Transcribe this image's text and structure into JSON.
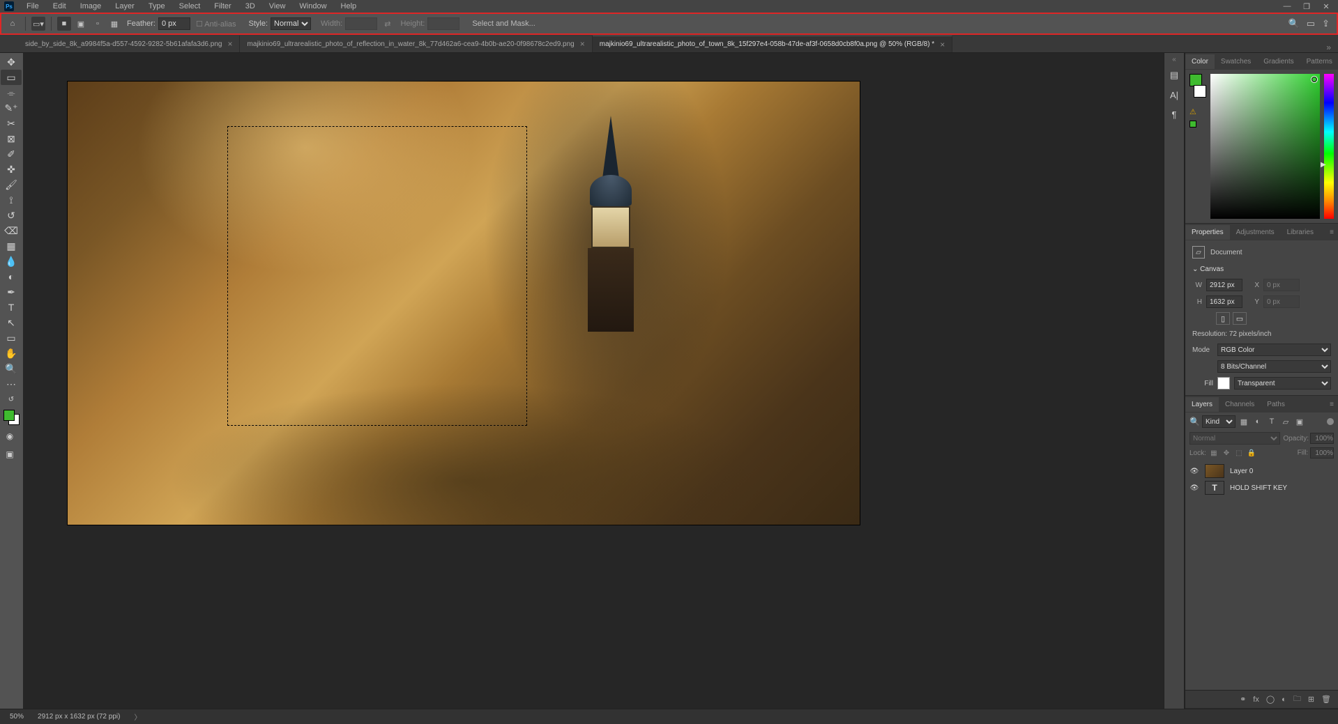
{
  "menu": [
    "File",
    "Edit",
    "Image",
    "Layer",
    "Type",
    "Select",
    "Filter",
    "3D",
    "View",
    "Window",
    "Help"
  ],
  "optionbar": {
    "feather_label": "Feather:",
    "feather_value": "0 px",
    "antialias": "Anti-alias",
    "style_label": "Style:",
    "style_value": "Normal",
    "width_label": "Width:",
    "height_label": "Height:",
    "select_mask": "Select and Mask..."
  },
  "tabs": [
    {
      "label": "side_by_side_8k_a9984f5a-d557-4592-9282-5b61afafa3d6.png",
      "active": false
    },
    {
      "label": "majkinio69_ultrarealistic_photo_of_reflection_in_water_8k_77d462a6-cea9-4b0b-ae20-0f98678c2ed9.png",
      "active": false
    },
    {
      "label": "majkinio69_ultrarealistic_photo_of_town_8k_15f297e4-058b-47de-af3f-0658d0cb8f0a.png @ 50% (RGB/8) *",
      "active": true
    }
  ],
  "color_tabs": [
    "Color",
    "Swatches",
    "Gradients",
    "Patterns"
  ],
  "props_tabs": [
    "Properties",
    "Adjustments",
    "Libraries"
  ],
  "props": {
    "doc_label": "Document",
    "canvas_label": "Canvas",
    "W_label": "W",
    "W": "2912 px",
    "X_label": "X",
    "X": "0 px",
    "H_label": "H",
    "H": "1632 px",
    "Y_label": "Y",
    "Y": "0 px",
    "reso_label": "Resolution:",
    "reso_value": "72 pixels/inch",
    "mode_label": "Mode",
    "mode_value": "RGB Color",
    "bits_value": "8 Bits/Channel",
    "fill_label": "Fill",
    "fill_value": "Transparent"
  },
  "layer_tabs": [
    "Layers",
    "Channels",
    "Paths"
  ],
  "layers": {
    "kind": "Kind",
    "blend": "Normal",
    "opacity_label": "Opacity:",
    "opacity": "100%",
    "lock_label": "Lock:",
    "fill_label": "Fill:",
    "fill": "100%",
    "items": [
      {
        "name": "Layer 0",
        "type": "image"
      },
      {
        "name": "HOLD SHIFT KEY",
        "type": "text"
      }
    ]
  },
  "status": {
    "zoom": "50%",
    "dims": "2912 px x 1632 px (72 ppi)"
  }
}
